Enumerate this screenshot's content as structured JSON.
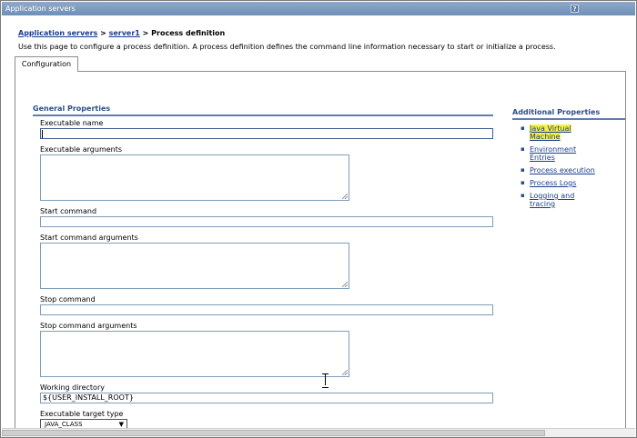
{
  "window": {
    "title": "Application servers",
    "help_label": "?"
  },
  "breadcrumb": {
    "link1": "Application servers",
    "sep1": " > ",
    "link2": "server1",
    "sep2": " > ",
    "current": "Process definition"
  },
  "description": "Use this page to configure a process definition. A process definition defines the command line information necessary to start or initialize a process.",
  "tabs": [
    {
      "label": "Configuration"
    }
  ],
  "general": {
    "title": "General Properties",
    "fields": {
      "executable_name": {
        "label": "Executable name",
        "value": ""
      },
      "executable_arguments": {
        "label": "Executable arguments",
        "value": ""
      },
      "start_command": {
        "label": "Start command",
        "value": ""
      },
      "start_command_arguments": {
        "label": "Start command arguments",
        "value": ""
      },
      "stop_command": {
        "label": "Stop command",
        "value": ""
      },
      "stop_command_arguments": {
        "label": "Stop command arguments",
        "value": ""
      },
      "working_directory": {
        "label": "Working directory",
        "value": "${USER_INSTALL_ROOT}"
      },
      "executable_target_type": {
        "label": "Executable target type",
        "value": "JAVA_CLASS"
      }
    }
  },
  "additional": {
    "title": "Additional Properties",
    "links": [
      {
        "line1": "Java Virtual",
        "line2": "Machine"
      },
      {
        "line1": "Environment",
        "line2": "Entries"
      },
      {
        "line1": "Process execution",
        "line2": ""
      },
      {
        "line1": "Process Logs",
        "line2": ""
      },
      {
        "line1": "Logging and",
        "line2": "tracing"
      }
    ]
  },
  "colors": {
    "link": "#1b3c8f",
    "section_title": "#2a4f87",
    "highlight": "#f6f23a",
    "titlebar": "#7b98bf"
  }
}
